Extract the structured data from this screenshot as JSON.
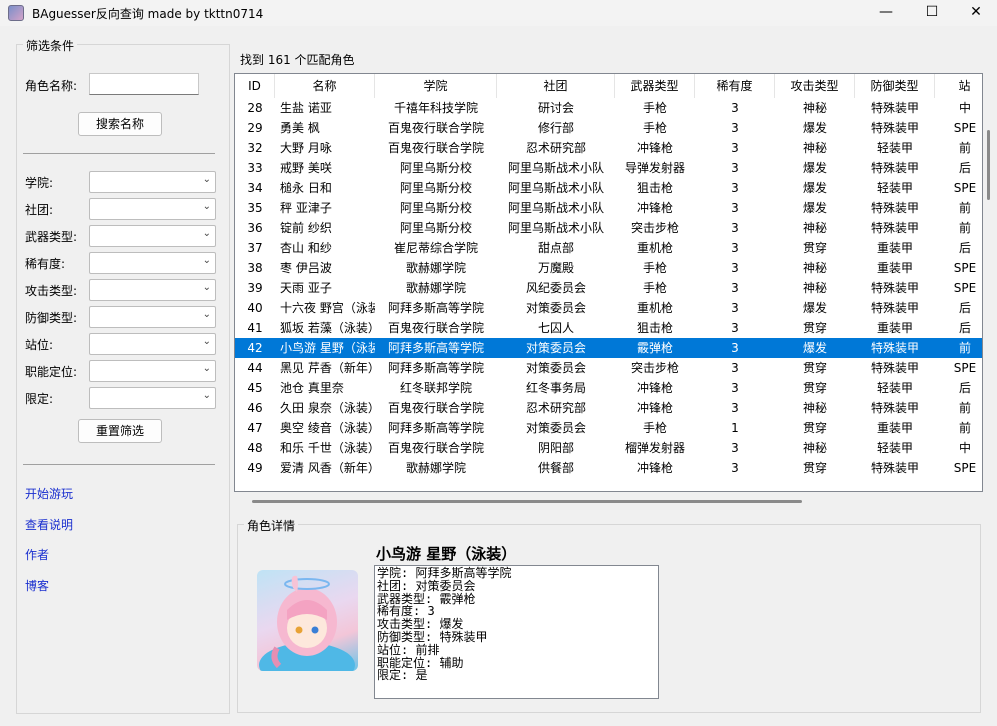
{
  "window": {
    "title": "BAguesser反向查询 made by tkttn0714",
    "minimize": "—",
    "maximize": "☐",
    "close": "✕"
  },
  "filters": {
    "group_title": "筛选条件",
    "name_label": "角色名称:",
    "name_value": "",
    "search_button": "搜索名称",
    "fields": [
      {
        "label": "学院:",
        "value": ""
      },
      {
        "label": "社团:",
        "value": ""
      },
      {
        "label": "武器类型:",
        "value": ""
      },
      {
        "label": "稀有度:",
        "value": ""
      },
      {
        "label": "攻击类型:",
        "value": ""
      },
      {
        "label": "防御类型:",
        "value": ""
      },
      {
        "label": "站位:",
        "value": ""
      },
      {
        "label": "职能定位:",
        "value": ""
      },
      {
        "label": "限定:",
        "value": ""
      }
    ],
    "reset_button": "重置筛选"
  },
  "links": [
    "开始游玩",
    "查看说明",
    "作者",
    "博客"
  ],
  "results": {
    "count_text": "找到 161 个匹配角色",
    "columns": [
      "ID",
      "名称",
      "学院",
      "社团",
      "武器类型",
      "稀有度",
      "攻击类型",
      "防御类型",
      "站"
    ],
    "rows": [
      [
        "28",
        "生盐 诺亚",
        "千禧年科技学院",
        "研讨会",
        "手枪",
        "3",
        "神秘",
        "特殊装甲",
        "中"
      ],
      [
        "29",
        "勇美 枫",
        "百鬼夜行联合学院",
        "修行部",
        "手枪",
        "3",
        "爆发",
        "特殊装甲",
        "SPE"
      ],
      [
        "32",
        "大野 月咏",
        "百鬼夜行联合学院",
        "忍术研究部",
        "冲锋枪",
        "3",
        "神秘",
        "轻装甲",
        "前"
      ],
      [
        "33",
        "戒野 美咲",
        "阿里乌斯分校",
        "阿里乌斯战术小队",
        "导弹发射器",
        "3",
        "爆发",
        "特殊装甲",
        "后"
      ],
      [
        "34",
        "槌永 日和",
        "阿里乌斯分校",
        "阿里乌斯战术小队",
        "狙击枪",
        "3",
        "爆发",
        "轻装甲",
        "SPE"
      ],
      [
        "35",
        "秤 亚津子",
        "阿里乌斯分校",
        "阿里乌斯战术小队",
        "冲锋枪",
        "3",
        "爆发",
        "特殊装甲",
        "前"
      ],
      [
        "36",
        "锭前 纱织",
        "阿里乌斯分校",
        "阿里乌斯战术小队",
        "突击步枪",
        "3",
        "神秘",
        "特殊装甲",
        "前"
      ],
      [
        "37",
        "杏山 和纱",
        "崔尼蒂综合学院",
        "甜点部",
        "重机枪",
        "3",
        "贯穿",
        "重装甲",
        "后"
      ],
      [
        "38",
        "枣 伊吕波",
        "歌赫娜学院",
        "万魔殿",
        "手枪",
        "3",
        "神秘",
        "重装甲",
        "SPE"
      ],
      [
        "39",
        "天雨 亚子",
        "歌赫娜学院",
        "风纪委员会",
        "手枪",
        "3",
        "神秘",
        "特殊装甲",
        "SPE"
      ],
      [
        "40",
        "十六夜 野宫（泳装）",
        "阿拜多斯高等学院",
        "对策委员会",
        "重机枪",
        "3",
        "爆发",
        "特殊装甲",
        "后"
      ],
      [
        "41",
        "狐坂 若藻（泳装）",
        "百鬼夜行联合学院",
        "七囚人",
        "狙击枪",
        "3",
        "贯穿",
        "重装甲",
        "后"
      ],
      [
        "42",
        "小鸟游 星野（泳装）",
        "阿拜多斯高等学院",
        "对策委员会",
        "霰弹枪",
        "3",
        "爆发",
        "特殊装甲",
        "前"
      ],
      [
        "44",
        "黑见 芹香（新年）",
        "阿拜多斯高等学院",
        "对策委员会",
        "突击步枪",
        "3",
        "贯穿",
        "特殊装甲",
        "SPE"
      ],
      [
        "45",
        "池仓 真里奈",
        "红冬联邦学院",
        "红冬事务局",
        "冲锋枪",
        "3",
        "贯穿",
        "轻装甲",
        "后"
      ],
      [
        "46",
        "久田 泉奈（泳装）",
        "百鬼夜行联合学院",
        "忍术研究部",
        "冲锋枪",
        "3",
        "神秘",
        "特殊装甲",
        "前"
      ],
      [
        "47",
        "奥空 绫音（泳装）",
        "阿拜多斯高等学院",
        "对策委员会",
        "手枪",
        "1",
        "贯穿",
        "重装甲",
        "前"
      ],
      [
        "48",
        "和乐 千世（泳装）",
        "百鬼夜行联合学院",
        "阴阳部",
        "榴弹发射器",
        "3",
        "神秘",
        "轻装甲",
        "中"
      ],
      [
        "49",
        "爱清 风香（新年）",
        "歌赫娜学院",
        "供餐部",
        "冲锋枪",
        "3",
        "贯穿",
        "特殊装甲",
        "SPE"
      ]
    ],
    "selected_index": 12
  },
  "detail": {
    "group_title": "角色详情",
    "name": "小鸟游 星野（泳装）",
    "lines": [
      "学院: 阿拜多斯高等学院",
      "社团: 对策委员会",
      "武器类型: 霰弹枪",
      "稀有度: 3",
      "攻击类型: 爆发",
      "防御类型: 特殊装甲",
      "站位: 前排",
      "职能定位: 辅助",
      "限定: 是"
    ]
  }
}
